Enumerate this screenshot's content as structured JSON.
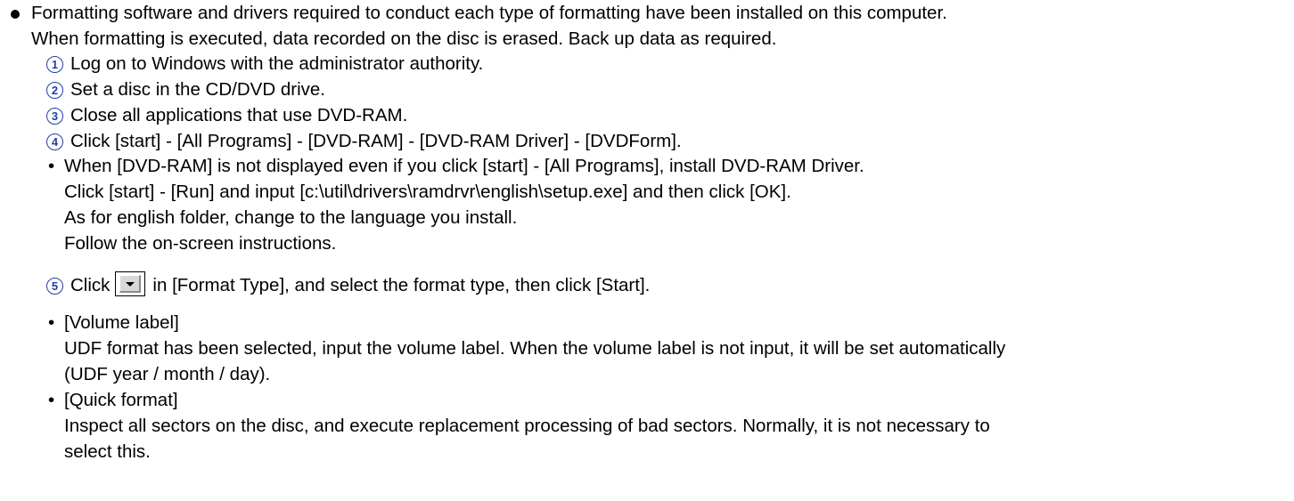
{
  "intro": {
    "line1": "Formatting software and drivers required to conduct each type of formatting have been installed on this computer.",
    "line2": "When formatting is executed, data recorded on the disc is erased. Back up data as required."
  },
  "steps": [
    {
      "marker": "1",
      "text": "Log on to Windows with the administrator authority."
    },
    {
      "marker": "2",
      "text": "Set a disc in the CD/DVD drive."
    },
    {
      "marker": "3",
      "text": "Close all applications that use DVD-RAM."
    },
    {
      "marker": "4",
      "text": "Click [start] - [All Programs] - [DVD-RAM] - [DVD-RAM Driver] - [DVDForm]."
    }
  ],
  "note_install": {
    "bullet": "•",
    "line1": "When [DVD-RAM] is not displayed even if you click [start] - [All Programs], install DVD-RAM Driver.",
    "line2": "Click [start] - [Run] and input [c:\\util\\drivers\\ramdrvr\\english\\setup.exe] and then click [OK].",
    "line3": "As for english folder, change to the language you install.",
    "line4": "Follow the on-screen instructions."
  },
  "step5": {
    "marker": "5",
    "before": "Click",
    "dropdown_icon": "dropdown-arrow-icon",
    "after": "in [Format Type], and select the format type, then click [Start]."
  },
  "note_volume": {
    "bullet": "•",
    "title": "[Volume label]",
    "line1": "UDF format has been selected, input the volume label. When the volume label is not input, it will be set automatically",
    "line2": "(UDF year / month / day)."
  },
  "note_quick": {
    "bullet": "•",
    "title": "[Quick format]",
    "line1": "Inspect all sectors on the disc, and execute replacement processing of bad sectors. Normally, it is not necessary to",
    "line2": "select this."
  },
  "colors": {
    "step_marker": "#1f3ea8",
    "text": "#000000"
  }
}
